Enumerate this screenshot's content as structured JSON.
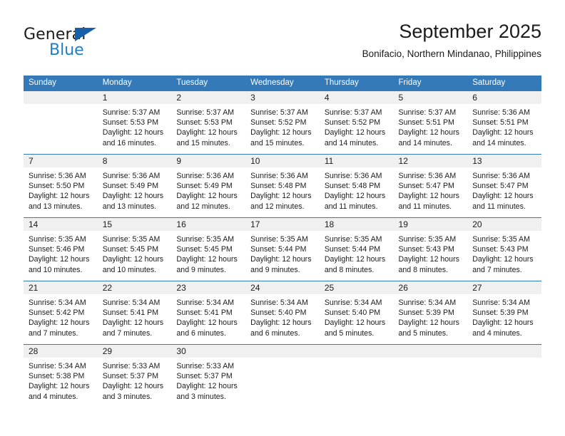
{
  "brand": {
    "name_primary": "General",
    "name_secondary": "Blue",
    "triangle_icon": "triangle-icon",
    "accent_color": "#3479b8",
    "logo_blue": "#1f7dc4"
  },
  "header": {
    "title": "September 2025",
    "subtitle": "Bonifacio, Northern Mindanao, Philippines"
  },
  "calendar": {
    "weekday_headers": [
      "Sunday",
      "Monday",
      "Tuesday",
      "Wednesday",
      "Thursday",
      "Friday",
      "Saturday"
    ],
    "weeks": [
      [
        {
          "day": "",
          "sunrise": "",
          "sunset": "",
          "daylight1": "",
          "daylight2": ""
        },
        {
          "day": "1",
          "sunrise": "Sunrise: 5:37 AM",
          "sunset": "Sunset: 5:53 PM",
          "daylight1": "Daylight: 12 hours",
          "daylight2": "and 16 minutes."
        },
        {
          "day": "2",
          "sunrise": "Sunrise: 5:37 AM",
          "sunset": "Sunset: 5:53 PM",
          "daylight1": "Daylight: 12 hours",
          "daylight2": "and 15 minutes."
        },
        {
          "day": "3",
          "sunrise": "Sunrise: 5:37 AM",
          "sunset": "Sunset: 5:52 PM",
          "daylight1": "Daylight: 12 hours",
          "daylight2": "and 15 minutes."
        },
        {
          "day": "4",
          "sunrise": "Sunrise: 5:37 AM",
          "sunset": "Sunset: 5:52 PM",
          "daylight1": "Daylight: 12 hours",
          "daylight2": "and 14 minutes."
        },
        {
          "day": "5",
          "sunrise": "Sunrise: 5:37 AM",
          "sunset": "Sunset: 5:51 PM",
          "daylight1": "Daylight: 12 hours",
          "daylight2": "and 14 minutes."
        },
        {
          "day": "6",
          "sunrise": "Sunrise: 5:36 AM",
          "sunset": "Sunset: 5:51 PM",
          "daylight1": "Daylight: 12 hours",
          "daylight2": "and 14 minutes."
        }
      ],
      [
        {
          "day": "7",
          "sunrise": "Sunrise: 5:36 AM",
          "sunset": "Sunset: 5:50 PM",
          "daylight1": "Daylight: 12 hours",
          "daylight2": "and 13 minutes."
        },
        {
          "day": "8",
          "sunrise": "Sunrise: 5:36 AM",
          "sunset": "Sunset: 5:49 PM",
          "daylight1": "Daylight: 12 hours",
          "daylight2": "and 13 minutes."
        },
        {
          "day": "9",
          "sunrise": "Sunrise: 5:36 AM",
          "sunset": "Sunset: 5:49 PM",
          "daylight1": "Daylight: 12 hours",
          "daylight2": "and 12 minutes."
        },
        {
          "day": "10",
          "sunrise": "Sunrise: 5:36 AM",
          "sunset": "Sunset: 5:48 PM",
          "daylight1": "Daylight: 12 hours",
          "daylight2": "and 12 minutes."
        },
        {
          "day": "11",
          "sunrise": "Sunrise: 5:36 AM",
          "sunset": "Sunset: 5:48 PM",
          "daylight1": "Daylight: 12 hours",
          "daylight2": "and 11 minutes."
        },
        {
          "day": "12",
          "sunrise": "Sunrise: 5:36 AM",
          "sunset": "Sunset: 5:47 PM",
          "daylight1": "Daylight: 12 hours",
          "daylight2": "and 11 minutes."
        },
        {
          "day": "13",
          "sunrise": "Sunrise: 5:36 AM",
          "sunset": "Sunset: 5:47 PM",
          "daylight1": "Daylight: 12 hours",
          "daylight2": "and 11 minutes."
        }
      ],
      [
        {
          "day": "14",
          "sunrise": "Sunrise: 5:35 AM",
          "sunset": "Sunset: 5:46 PM",
          "daylight1": "Daylight: 12 hours",
          "daylight2": "and 10 minutes."
        },
        {
          "day": "15",
          "sunrise": "Sunrise: 5:35 AM",
          "sunset": "Sunset: 5:45 PM",
          "daylight1": "Daylight: 12 hours",
          "daylight2": "and 10 minutes."
        },
        {
          "day": "16",
          "sunrise": "Sunrise: 5:35 AM",
          "sunset": "Sunset: 5:45 PM",
          "daylight1": "Daylight: 12 hours",
          "daylight2": "and 9 minutes."
        },
        {
          "day": "17",
          "sunrise": "Sunrise: 5:35 AM",
          "sunset": "Sunset: 5:44 PM",
          "daylight1": "Daylight: 12 hours",
          "daylight2": "and 9 minutes."
        },
        {
          "day": "18",
          "sunrise": "Sunrise: 5:35 AM",
          "sunset": "Sunset: 5:44 PM",
          "daylight1": "Daylight: 12 hours",
          "daylight2": "and 8 minutes."
        },
        {
          "day": "19",
          "sunrise": "Sunrise: 5:35 AM",
          "sunset": "Sunset: 5:43 PM",
          "daylight1": "Daylight: 12 hours",
          "daylight2": "and 8 minutes."
        },
        {
          "day": "20",
          "sunrise": "Sunrise: 5:35 AM",
          "sunset": "Sunset: 5:43 PM",
          "daylight1": "Daylight: 12 hours",
          "daylight2": "and 7 minutes."
        }
      ],
      [
        {
          "day": "21",
          "sunrise": "Sunrise: 5:34 AM",
          "sunset": "Sunset: 5:42 PM",
          "daylight1": "Daylight: 12 hours",
          "daylight2": "and 7 minutes."
        },
        {
          "day": "22",
          "sunrise": "Sunrise: 5:34 AM",
          "sunset": "Sunset: 5:41 PM",
          "daylight1": "Daylight: 12 hours",
          "daylight2": "and 7 minutes."
        },
        {
          "day": "23",
          "sunrise": "Sunrise: 5:34 AM",
          "sunset": "Sunset: 5:41 PM",
          "daylight1": "Daylight: 12 hours",
          "daylight2": "and 6 minutes."
        },
        {
          "day": "24",
          "sunrise": "Sunrise: 5:34 AM",
          "sunset": "Sunset: 5:40 PM",
          "daylight1": "Daylight: 12 hours",
          "daylight2": "and 6 minutes."
        },
        {
          "day": "25",
          "sunrise": "Sunrise: 5:34 AM",
          "sunset": "Sunset: 5:40 PM",
          "daylight1": "Daylight: 12 hours",
          "daylight2": "and 5 minutes."
        },
        {
          "day": "26",
          "sunrise": "Sunrise: 5:34 AM",
          "sunset": "Sunset: 5:39 PM",
          "daylight1": "Daylight: 12 hours",
          "daylight2": "and 5 minutes."
        },
        {
          "day": "27",
          "sunrise": "Sunrise: 5:34 AM",
          "sunset": "Sunset: 5:39 PM",
          "daylight1": "Daylight: 12 hours",
          "daylight2": "and 4 minutes."
        }
      ],
      [
        {
          "day": "28",
          "sunrise": "Sunrise: 5:34 AM",
          "sunset": "Sunset: 5:38 PM",
          "daylight1": "Daylight: 12 hours",
          "daylight2": "and 4 minutes."
        },
        {
          "day": "29",
          "sunrise": "Sunrise: 5:33 AM",
          "sunset": "Sunset: 5:37 PM",
          "daylight1": "Daylight: 12 hours",
          "daylight2": "and 3 minutes."
        },
        {
          "day": "30",
          "sunrise": "Sunrise: 5:33 AM",
          "sunset": "Sunset: 5:37 PM",
          "daylight1": "Daylight: 12 hours",
          "daylight2": "and 3 minutes."
        },
        {
          "day": "",
          "sunrise": "",
          "sunset": "",
          "daylight1": "",
          "daylight2": ""
        },
        {
          "day": "",
          "sunrise": "",
          "sunset": "",
          "daylight1": "",
          "daylight2": ""
        },
        {
          "day": "",
          "sunrise": "",
          "sunset": "",
          "daylight1": "",
          "daylight2": ""
        },
        {
          "day": "",
          "sunrise": "",
          "sunset": "",
          "daylight1": "",
          "daylight2": ""
        }
      ]
    ]
  }
}
